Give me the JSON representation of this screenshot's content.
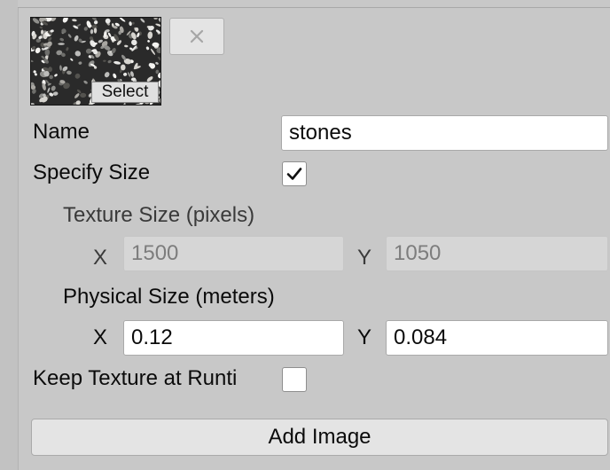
{
  "image_item": {
    "select_label": "Select",
    "thumbnail_icon": "stones-texture-thumbnail",
    "remove_icon": "close-icon"
  },
  "name": {
    "label": "Name",
    "value": "stones"
  },
  "specify_size": {
    "label": "Specify Size",
    "checked": true
  },
  "texture_size": {
    "label": "Texture Size (pixels)",
    "x_label": "X",
    "x_value": "1500",
    "y_label": "Y",
    "y_value": "1050"
  },
  "physical_size": {
    "label": "Physical Size (meters)",
    "x_label": "X",
    "x_value": "0.12",
    "y_label": "Y",
    "y_value": "0.084"
  },
  "keep_texture": {
    "label": "Keep Texture at Runti",
    "checked": false
  },
  "add_image": {
    "label": "Add Image"
  }
}
